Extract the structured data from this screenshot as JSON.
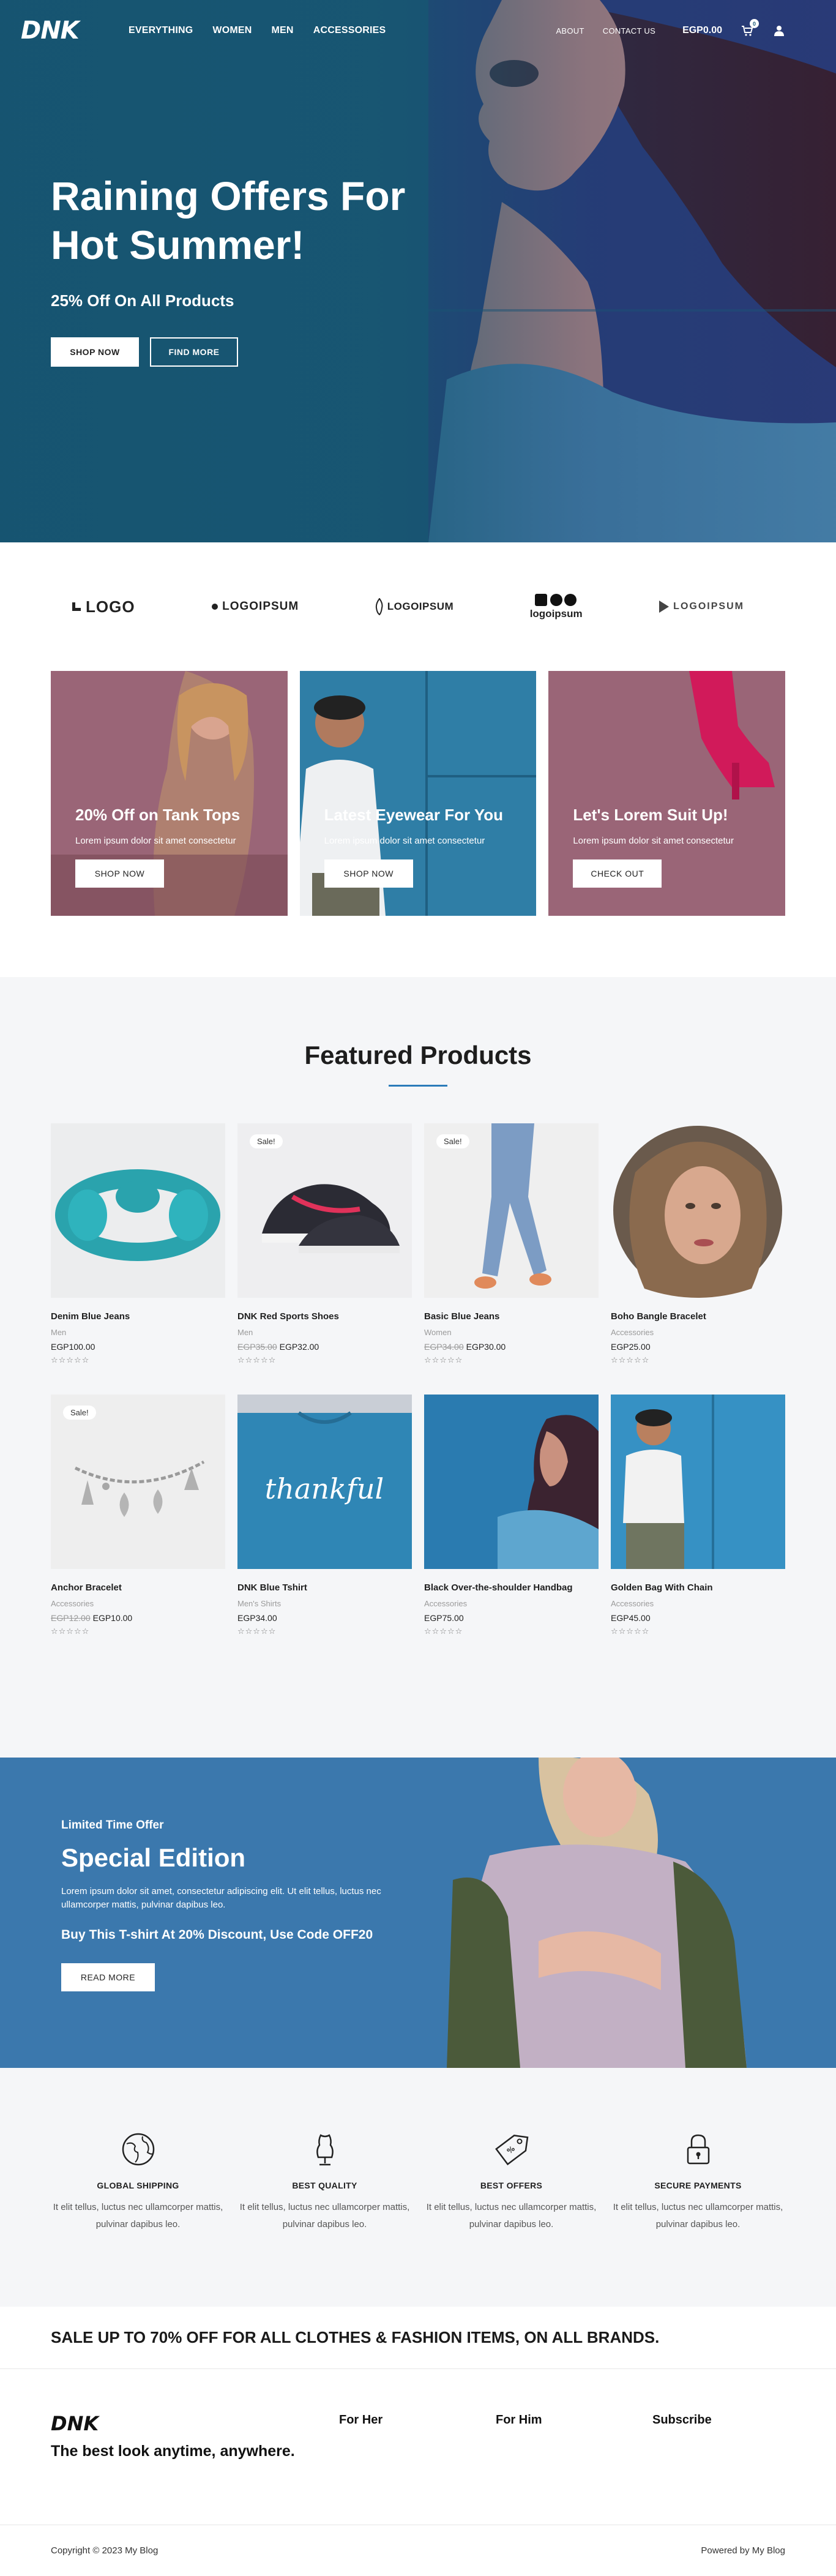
{
  "brand": "DNK",
  "nav": {
    "items": [
      "EVERYTHING",
      "WOMEN",
      "MEN",
      "ACCESSORIES"
    ],
    "right_links": [
      "ABOUT",
      "CONTACT US"
    ],
    "cart_total": "EGP0.00",
    "cart_count": "0"
  },
  "hero": {
    "title": "Raining Offers For Hot Summer!",
    "subtitle": "25% Off On All Products",
    "primary_btn": "SHOP NOW",
    "secondary_btn": "FIND MORE"
  },
  "logos": [
    {
      "label": "LOGO",
      "icon": "square-mark-icon"
    },
    {
      "label": "LOGOIPSUM",
      "icon": "wave-mark-icon"
    },
    {
      "label": "LOGOIPSUM",
      "icon": "flame-mark-icon"
    },
    {
      "label": "logoipsum",
      "icon": "circles-mark-icon"
    },
    {
      "label": "LOGOIPSUM",
      "icon": "triangle-mark-icon"
    }
  ],
  "promos": [
    {
      "title": "20% Off on Tank Tops",
      "text": "Lorem ipsum dolor sit amet consectetur",
      "button": "SHOP NOW"
    },
    {
      "title": "Latest Eyewear For You",
      "text": "Lorem ipsum dolor sit amet consectetur",
      "button": "SHOP NOW"
    },
    {
      "title": "Let's Lorem Suit Up!",
      "text": "Lorem ipsum dolor sit amet consectetur",
      "button": "CHECK OUT"
    }
  ],
  "featured": {
    "title": "Featured Products",
    "sale_badge": "Sale!",
    "stars": "☆☆☆☆☆",
    "products": [
      {
        "name": "Denim Blue Jeans",
        "category": "Men",
        "old_price": "",
        "price": "EGP100.00",
        "sale": false
      },
      {
        "name": "DNK Red Sports Shoes",
        "category": "Men",
        "old_price": "EGP35.00",
        "price": "EGP32.00",
        "sale": true
      },
      {
        "name": "Basic Blue Jeans",
        "category": "Women",
        "old_price": "EGP34.00",
        "price": "EGP30.00",
        "sale": true
      },
      {
        "name": "Boho Bangle Bracelet",
        "category": "Accessories",
        "old_price": "",
        "price": "EGP25.00",
        "sale": false
      },
      {
        "name": "Anchor Bracelet",
        "category": "Accessories",
        "old_price": "EGP12.00",
        "price": "EGP10.00",
        "sale": true
      },
      {
        "name": "DNK Blue Tshirt",
        "category": "Men's Shirts",
        "old_price": "",
        "price": "EGP34.00",
        "sale": false
      },
      {
        "name": "Black Over-the-shoulder Handbag",
        "category": "Accessories",
        "old_price": "",
        "price": "EGP75.00",
        "sale": false
      },
      {
        "name": "Golden Bag With Chain",
        "category": "Accessories",
        "old_price": "",
        "price": "EGP45.00",
        "sale": false
      }
    ]
  },
  "special": {
    "eyebrow": "Limited Time Offer",
    "title": "Special Edition",
    "text": "Lorem ipsum dolor sit amet, consectetur adipiscing elit. Ut elit tellus, luctus nec ullamcorper mattis, pulvinar dapibus leo.",
    "offer": "Buy This T-shirt At 20% Discount, Use Code OFF20",
    "button": "READ MORE"
  },
  "features": [
    {
      "title": "GLOBAL SHIPPING",
      "text": "It elit tellus, luctus nec ullamcorper mattis, pulvinar dapibus leo.",
      "icon": "globe-icon"
    },
    {
      "title": "BEST QUALITY",
      "text": "It elit tellus, luctus nec ullamcorper mattis, pulvinar dapibus leo.",
      "icon": "dress-form-icon"
    },
    {
      "title": "BEST OFFERS",
      "text": "It elit tellus, luctus nec ullamcorper mattis, pulvinar dapibus leo.",
      "icon": "price-tag-icon"
    },
    {
      "title": "SECURE PAYMENTS",
      "text": "It elit tellus, luctus nec ullamcorper mattis, pulvinar dapibus leo.",
      "icon": "lock-icon"
    }
  ],
  "sale_banner": "SALE UP TO 70% OFF FOR ALL CLOTHES & FASHION ITEMS, ON ALL BRANDS.",
  "footer": {
    "brand": "DNK",
    "tagline": "The best look anytime, anywhere.",
    "col1": "For Her",
    "col2": "For Him",
    "col3": "Subscribe",
    "copyright": "Copyright © 2023 My Blog",
    "powered": "Powered by My Blog"
  },
  "colors": {
    "hero_blue": "#1c5a78",
    "accent_blue": "#2b7bb9",
    "special_blue": "#3b78ad",
    "promo_mauve": "#9a6577",
    "light_bg": "#f5f6f8"
  }
}
